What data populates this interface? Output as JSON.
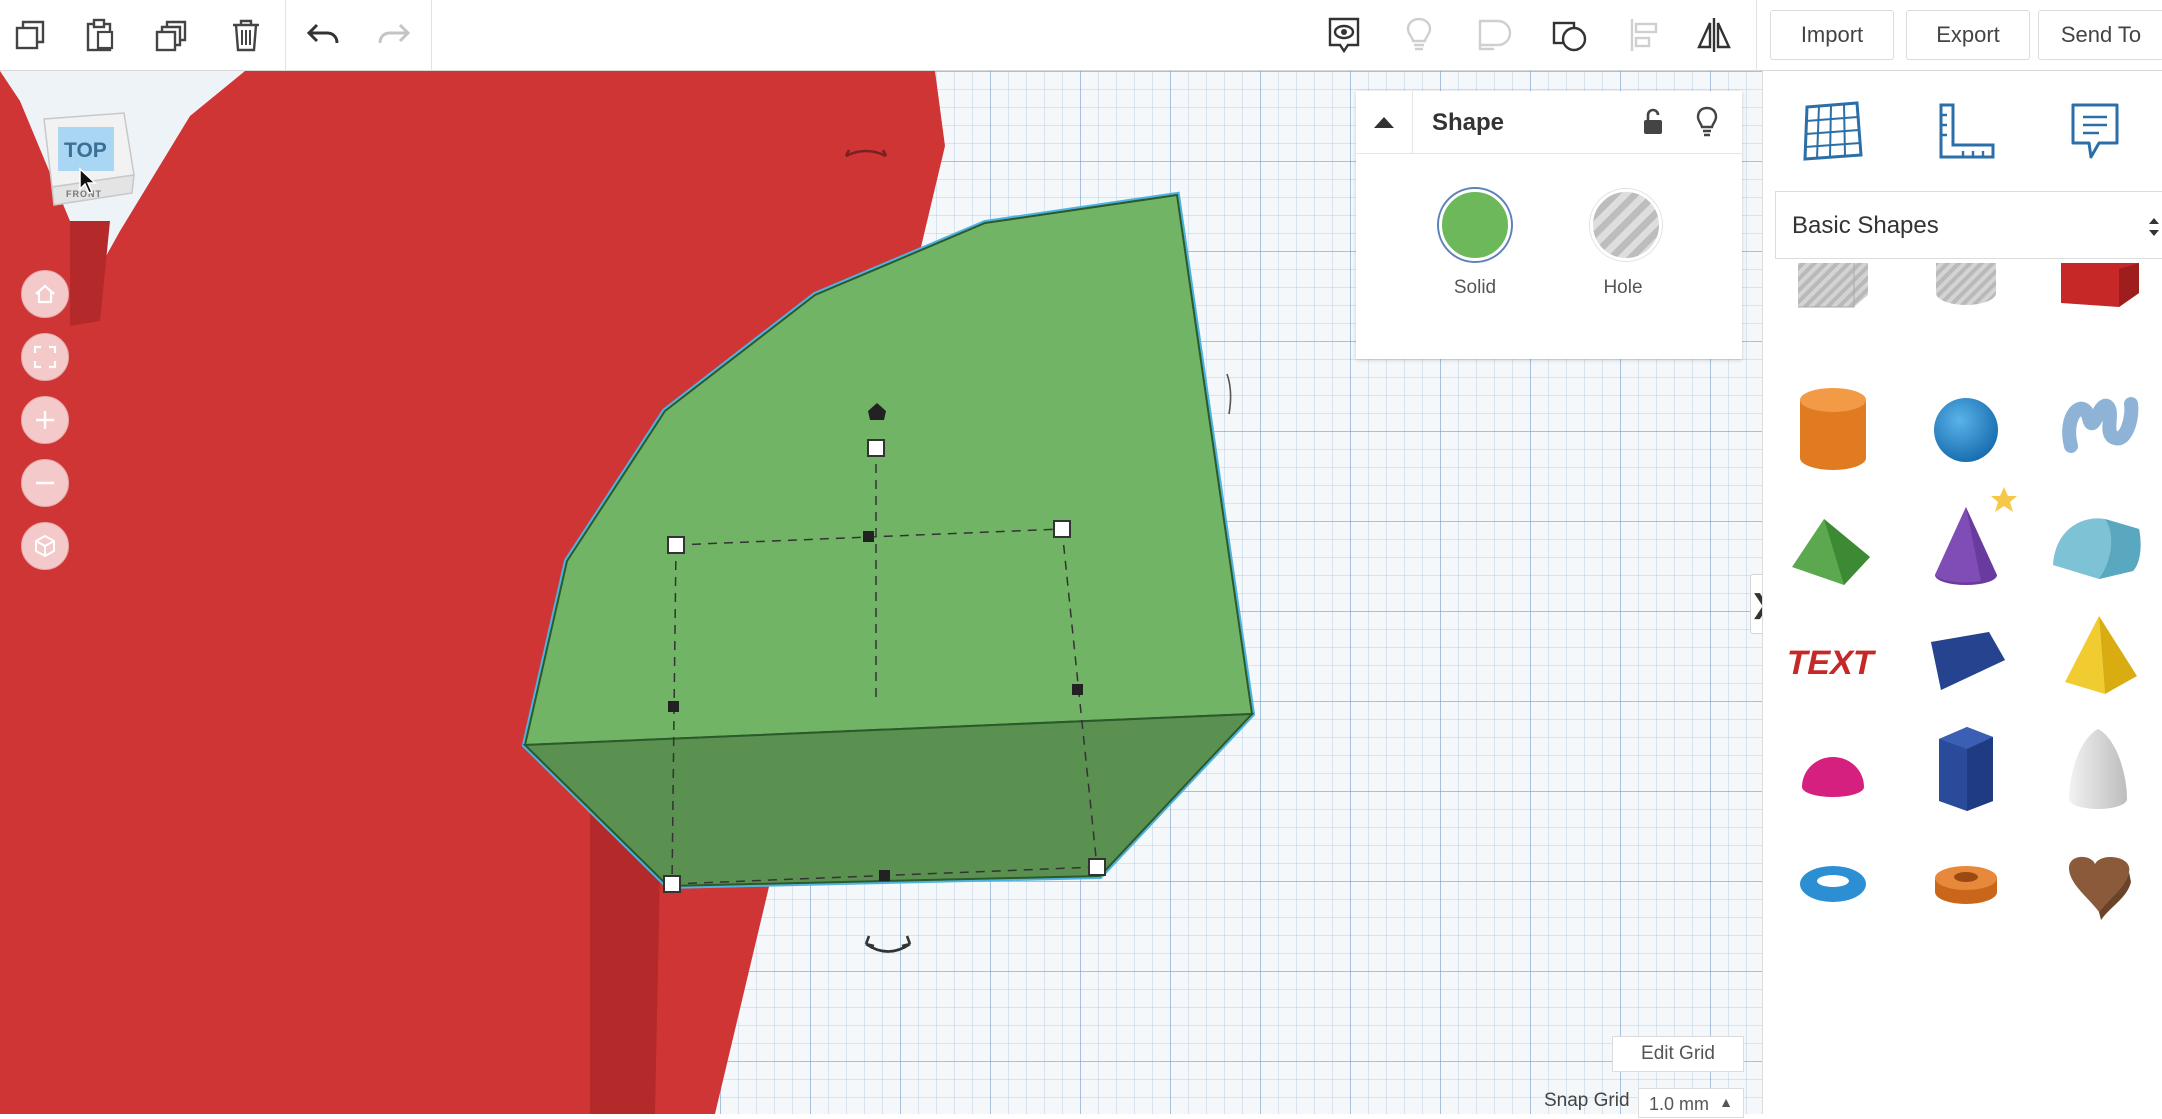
{
  "toolbar": {
    "left_tools": [
      {
        "name": "copy",
        "icon": "copy-icon"
      },
      {
        "name": "paste",
        "icon": "paste-icon"
      },
      {
        "name": "duplicate",
        "icon": "duplicate-icon"
      },
      {
        "name": "delete",
        "icon": "trash-icon"
      },
      {
        "name": "undo",
        "icon": "undo-icon"
      },
      {
        "name": "redo",
        "icon": "redo-icon"
      }
    ],
    "right_tools": [
      {
        "name": "show-all",
        "icon": "eye-icon"
      },
      {
        "name": "hide",
        "icon": "lightbulb-icon"
      },
      {
        "name": "group",
        "icon": "group-icon"
      },
      {
        "name": "ungroup",
        "icon": "ungroup-icon"
      },
      {
        "name": "align",
        "icon": "align-icon"
      },
      {
        "name": "mirror",
        "icon": "mirror-icon"
      }
    ],
    "import_label": "Import",
    "export_label": "Export",
    "send_to_label": "Send To"
  },
  "viewcube": {
    "face_label": "TOP",
    "side_label": "FRONT"
  },
  "nav_controls": [
    {
      "name": "home",
      "icon": "home-icon"
    },
    {
      "name": "fit",
      "icon": "fit-view-icon"
    },
    {
      "name": "zoom-in",
      "icon": "plus-icon"
    },
    {
      "name": "zoom-out",
      "icon": "minus-icon"
    },
    {
      "name": "ortho",
      "icon": "cube-icon"
    }
  ],
  "inspector": {
    "title": "Shape",
    "solid_label": "Solid",
    "hole_label": "Hole",
    "solid_color": "#6cb85a",
    "hole_color": "#c8c8c8"
  },
  "sidebar": {
    "tools": [
      {
        "name": "workplane",
        "icon": "workplane-icon"
      },
      {
        "name": "ruler",
        "icon": "ruler-icon"
      },
      {
        "name": "notes",
        "icon": "note-icon"
      }
    ],
    "category_label": "Basic Shapes",
    "shapes": [
      {
        "name": "box-hole",
        "icon": "box-hole-icon"
      },
      {
        "name": "cylinder-hole",
        "icon": "cylinder-hole-icon"
      },
      {
        "name": "box",
        "icon": "box-icon"
      },
      {
        "name": "cylinder",
        "icon": "cylinder-icon"
      },
      {
        "name": "sphere",
        "icon": "sphere-icon"
      },
      {
        "name": "scribble",
        "icon": "scribble-icon"
      },
      {
        "name": "roof",
        "icon": "roof-icon"
      },
      {
        "name": "cone",
        "icon": "cone-icon"
      },
      {
        "name": "round-roof",
        "icon": "round-roof-icon"
      },
      {
        "name": "text",
        "icon": "text-icon"
      },
      {
        "name": "wedge",
        "icon": "wedge-icon"
      },
      {
        "name": "pyramid",
        "icon": "pyramid-icon"
      },
      {
        "name": "half-sphere",
        "icon": "half-sphere-icon"
      },
      {
        "name": "polygon",
        "icon": "polygon-icon"
      },
      {
        "name": "paraboloid",
        "icon": "paraboloid-icon"
      },
      {
        "name": "torus",
        "icon": "torus-icon"
      },
      {
        "name": "tube",
        "icon": "tube-icon"
      },
      {
        "name": "heart",
        "icon": "heart-icon"
      }
    ]
  },
  "footer": {
    "edit_grid_label": "Edit Grid",
    "snap_grid_label": "Snap Grid",
    "snap_grid_value": "1.0 mm"
  },
  "colors": {
    "red_shape": "#d03535",
    "green_shape": "#72b465",
    "selection_outline": "#4fb3e0",
    "accent": "#2b6ea8"
  }
}
